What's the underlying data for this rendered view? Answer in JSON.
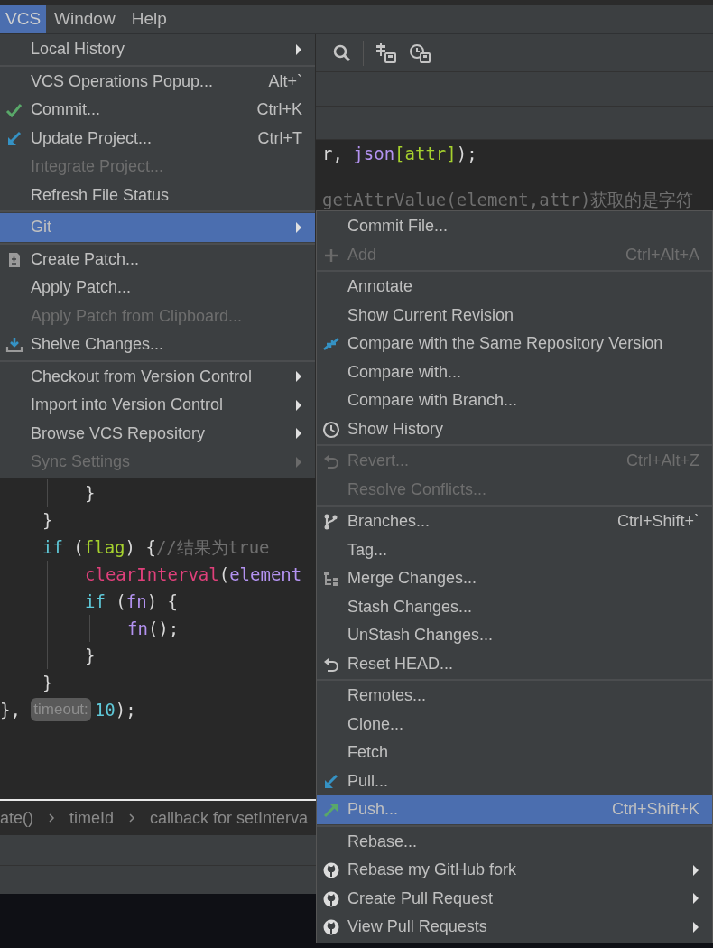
{
  "menubar": [
    {
      "label": "VCS",
      "selected": true
    },
    {
      "label": "Window",
      "selected": false
    },
    {
      "label": "Help",
      "selected": false
    }
  ],
  "editor_top_lines": [
    [
      {
        "kind": "plain",
        "text": "r, "
      },
      {
        "kind": "var",
        "text": "json"
      },
      {
        "kind": "green",
        "text": "[attr]"
      },
      {
        "kind": "plain",
        "text": ");"
      }
    ],
    [
      {
        "kind": "comment",
        "text": "getAttrValue(element,attr)获取的是字符"
      }
    ]
  ],
  "editor_lines": [
    {
      "children": [
        {
          "children": [
            {
              "tokens": [
                {
                  "kind": "plain",
                  "text": "}"
                }
              ]
            }
          ]
        },
        {
          "tokens": [
            {
              "kind": "plain",
              "text": "}"
            }
          ]
        },
        {
          "tokens": [
            {
              "kind": "keyword",
              "text": "if"
            },
            {
              "kind": "plain",
              "text": " ("
            },
            {
              "kind": "green",
              "text": "flag"
            },
            {
              "kind": "plain",
              "text": ") {"
            },
            {
              "kind": "comment",
              "text": "//结果为true"
            }
          ],
          "children": [
            {
              "tokens": [
                {
                  "kind": "func",
                  "text": "clearInterval"
                },
                {
                  "kind": "plain",
                  "text": "("
                },
                {
                  "kind": "var",
                  "text": "element"
                }
              ]
            },
            {
              "tokens": [
                {
                  "kind": "keyword",
                  "text": "if"
                },
                {
                  "kind": "plain",
                  "text": " ("
                },
                {
                  "kind": "var",
                  "text": "fn"
                },
                {
                  "kind": "plain",
                  "text": ") {"
                }
              ],
              "children": [
                {
                  "tokens": [
                    {
                      "kind": "var",
                      "text": "fn"
                    },
                    {
                      "kind": "plain",
                      "text": "();"
                    }
                  ]
                }
              ]
            },
            {
              "tokens": [
                {
                  "kind": "plain",
                  "text": "}"
                }
              ]
            }
          ]
        },
        {
          "tokens": [
            {
              "kind": "plain",
              "text": "}"
            }
          ]
        }
      ]
    },
    {
      "tokens": [
        {
          "kind": "plain",
          "text": "}, "
        },
        {
          "kind": "hint",
          "text": "timeout:"
        },
        {
          "kind": "number",
          "text": "10"
        },
        {
          "kind": "plain",
          "text": ");"
        }
      ]
    }
  ],
  "breadcrumb": [
    "ate()",
    "timeId",
    "callback for setInterva"
  ],
  "vcs_menu": [
    [
      {
        "label": "Local History",
        "kind": "none",
        "disabled": false,
        "selected": false,
        "has_submenu": true
      }
    ],
    [
      {
        "label": "VCS Operations Popup...",
        "shortcut": "Alt+`",
        "kind": "none",
        "disabled": false,
        "selected": false,
        "has_submenu": false
      },
      {
        "label": "Commit...",
        "shortcut": "Ctrl+K",
        "kind": "check",
        "disabled": false,
        "selected": false,
        "has_submenu": false
      },
      {
        "label": "Update Project...",
        "shortcut": "Ctrl+T",
        "kind": "update",
        "disabled": false,
        "selected": false,
        "has_submenu": false
      },
      {
        "label": "Integrate Project...",
        "kind": "none",
        "disabled": true,
        "selected": false,
        "has_submenu": false
      },
      {
        "label": "Refresh File Status",
        "kind": "none",
        "disabled": false,
        "selected": false,
        "has_submenu": false
      }
    ],
    [
      {
        "label": "Git",
        "kind": "none",
        "disabled": false,
        "selected": true,
        "has_submenu": true
      }
    ],
    [
      {
        "label": "Create Patch...",
        "kind": "patch",
        "disabled": false,
        "selected": false,
        "has_submenu": false
      },
      {
        "label": "Apply Patch...",
        "kind": "none",
        "disabled": false,
        "selected": false,
        "has_submenu": false
      },
      {
        "label": "Apply Patch from Clipboard...",
        "kind": "none",
        "disabled": true,
        "selected": false,
        "has_submenu": false
      },
      {
        "label": "Shelve Changes...",
        "kind": "shelve",
        "disabled": false,
        "selected": false,
        "has_submenu": false
      }
    ],
    [
      {
        "label": "Checkout from Version Control",
        "kind": "none",
        "disabled": false,
        "selected": false,
        "has_submenu": true
      },
      {
        "label": "Import into Version Control",
        "kind": "none",
        "disabled": false,
        "selected": false,
        "has_submenu": true
      },
      {
        "label": "Browse VCS Repository",
        "kind": "none",
        "disabled": false,
        "selected": false,
        "has_submenu": true
      },
      {
        "label": "Sync Settings",
        "kind": "none",
        "disabled": true,
        "selected": false,
        "has_submenu": true
      }
    ]
  ],
  "git_menu": [
    [
      {
        "label": "Commit File...",
        "kind": "none",
        "disabled": false,
        "selected": false,
        "has_submenu": false
      },
      {
        "label": "Add",
        "shortcut": "Ctrl+Alt+A",
        "kind": "plus",
        "disabled": true,
        "selected": false,
        "has_submenu": false
      }
    ],
    [
      {
        "label": "Annotate",
        "kind": "none",
        "disabled": false,
        "selected": false,
        "has_submenu": false
      },
      {
        "label": "Show Current Revision",
        "kind": "none",
        "disabled": false,
        "selected": false,
        "has_submenu": false
      },
      {
        "label": "Compare with the Same Repository Version",
        "kind": "compare",
        "disabled": false,
        "selected": false,
        "has_submenu": false
      },
      {
        "label": "Compare with...",
        "kind": "none",
        "disabled": false,
        "selected": false,
        "has_submenu": false
      },
      {
        "label": "Compare with Branch...",
        "kind": "none",
        "disabled": false,
        "selected": false,
        "has_submenu": false
      },
      {
        "label": "Show History",
        "kind": "clock",
        "disabled": false,
        "selected": false,
        "has_submenu": false
      }
    ],
    [
      {
        "label": "Revert...",
        "shortcut": "Ctrl+Alt+Z",
        "kind": "revert",
        "disabled": true,
        "selected": false,
        "has_submenu": false
      },
      {
        "label": "Resolve Conflicts...",
        "kind": "none",
        "disabled": true,
        "selected": false,
        "has_submenu": false
      }
    ],
    [
      {
        "label": "Branches...",
        "shortcut": "Ctrl+Shift+`",
        "kind": "branch",
        "disabled": false,
        "selected": false,
        "has_submenu": false
      },
      {
        "label": "Tag...",
        "kind": "none",
        "disabled": false,
        "selected": false,
        "has_submenu": false
      },
      {
        "label": "Merge Changes...",
        "kind": "merge",
        "disabled": false,
        "selected": false,
        "has_submenu": false
      },
      {
        "label": "Stash Changes...",
        "kind": "none",
        "disabled": false,
        "selected": false,
        "has_submenu": false
      },
      {
        "label": "UnStash Changes...",
        "kind": "none",
        "disabled": false,
        "selected": false,
        "has_submenu": false
      },
      {
        "label": "Reset HEAD...",
        "kind": "revert",
        "disabled": false,
        "selected": false,
        "has_submenu": false
      }
    ],
    [
      {
        "label": "Remotes...",
        "kind": "none",
        "disabled": false,
        "selected": false,
        "has_submenu": false
      },
      {
        "label": "Clone...",
        "kind": "none",
        "disabled": false,
        "selected": false,
        "has_submenu": false
      },
      {
        "label": "Fetch",
        "kind": "none",
        "disabled": false,
        "selected": false,
        "has_submenu": false
      },
      {
        "label": "Pull...",
        "kind": "update",
        "disabled": false,
        "selected": false,
        "has_submenu": false
      },
      {
        "label": "Push...",
        "shortcut": "Ctrl+Shift+K",
        "kind": "push",
        "disabled": false,
        "selected": true,
        "has_submenu": false
      }
    ],
    [
      {
        "label": "Rebase...",
        "kind": "none",
        "disabled": false,
        "selected": false,
        "has_submenu": false
      },
      {
        "label": "Rebase my GitHub fork",
        "kind": "github",
        "disabled": false,
        "selected": false,
        "has_submenu": true
      },
      {
        "label": "Create Pull Request",
        "kind": "github",
        "disabled": false,
        "selected": false,
        "has_submenu": true
      },
      {
        "label": "View Pull Requests",
        "kind": "github",
        "disabled": false,
        "selected": false,
        "has_submenu": true
      }
    ]
  ]
}
